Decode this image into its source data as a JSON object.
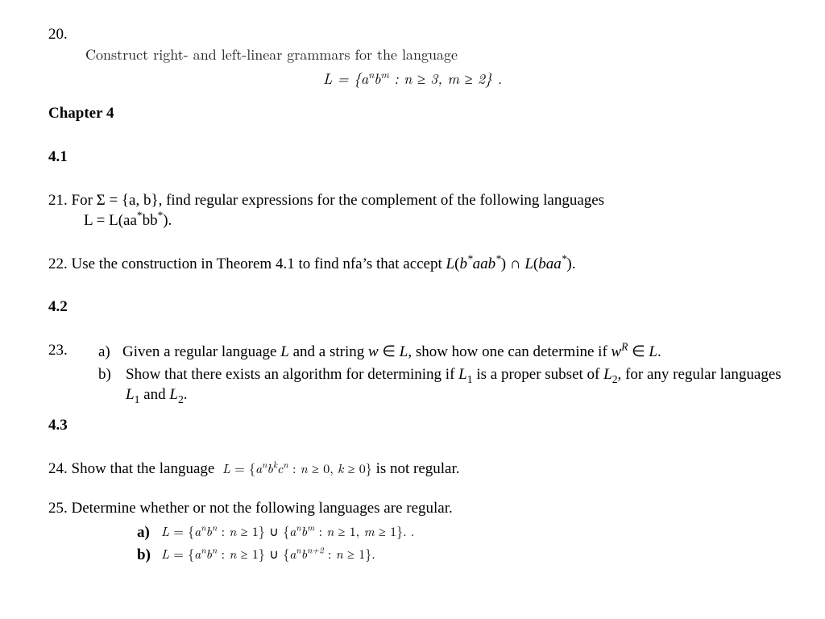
{
  "q20": {
    "num": "20.",
    "text": "Construct right- and left-linear grammars for the language",
    "eq_html": "<span class='italic'>L</span> = {<span class='italic'>a<sup>n</sup>b<sup>m</sup></span> : <span class='italic'>n</span> ≥ 3, <span class='italic'>m</span> ≥ 2} ."
  },
  "chapter": "Chapter 4",
  "sec41": "4.1",
  "q21": {
    "line1_html": "21. For Σ = {a, b}, find regular expressions for the complement of the following languages",
    "line2_html": "L = L(aa<sup>*</sup>bb<sup>*</sup>)."
  },
  "q22_html": "22. Use the construction in Theorem 4.1 to find nfa’s that accept <span class='italic'>L</span>(<span class='italic'>b<sup>*</sup>aab<sup>*</sup></span>) ∩ <span class='italic'>L</span>(<span class='italic'>baa<sup>*</sup></span>).",
  "sec42": "4.2",
  "q23": {
    "num": "23.",
    "a_lbl": "a)",
    "a_html": "Given a regular language <span class='italic'>L</span> and a string <span class='italic'>w</span> ∈ <span class='italic'>L</span>, show how one can determine if <span class='italic'>w<sup>R</sup></span> ∈ <span class='italic'>L</span>.",
    "b_lbl": "b)",
    "b_html": "Show that there exists an algorithm for determining if <span class='italic'>L</span><sub class='s'>1</sub> is a proper subset of <span class='italic'>L</span><sub class='s'>2</sub>, for any regular languages <span class='italic'>L</span><sub class='s'>1</sub> and <span class='italic'>L</span><sub class='s'>2</sub>."
  },
  "sec43": "4.3",
  "q24_html": "24. Show that the language&nbsp; <span class='small-eq'><span class='italic'>L</span> = {<span class='italic'>a<sup>n</sup>b<sup>k</sup>c<sup>n</sup></span> : <span class='italic'>n</span> ≥ 0, <span class='italic'>k</span> ≥ 0}</span> is not regular.",
  "q25": {
    "intro": "25. Determine whether or not the following languages are regular.",
    "a_lbl": "a)",
    "a_html": "<span class='italic'>L</span> = {<span class='italic'>a<sup>n</sup>b<sup>n</sup></span> : <span class='italic'>n</span> ≥ 1} ∪ {<span class='italic'>a<sup>n</sup>b<sup>m</sup></span> : <span class='italic'>n</span> ≥ 1, <span class='italic'>m</span> ≥ 1}. .",
    "b_lbl": "b)",
    "b_html": "<span class='italic'>L</span> = {<span class='italic'>a<sup>n</sup>b<sup>n</sup></span> : <span class='italic'>n</span> ≥ 1} ∪ {<span class='italic'>a<sup>n</sup>b<sup>n+2</sup></span> : <span class='italic'>n</span> ≥ 1}."
  }
}
